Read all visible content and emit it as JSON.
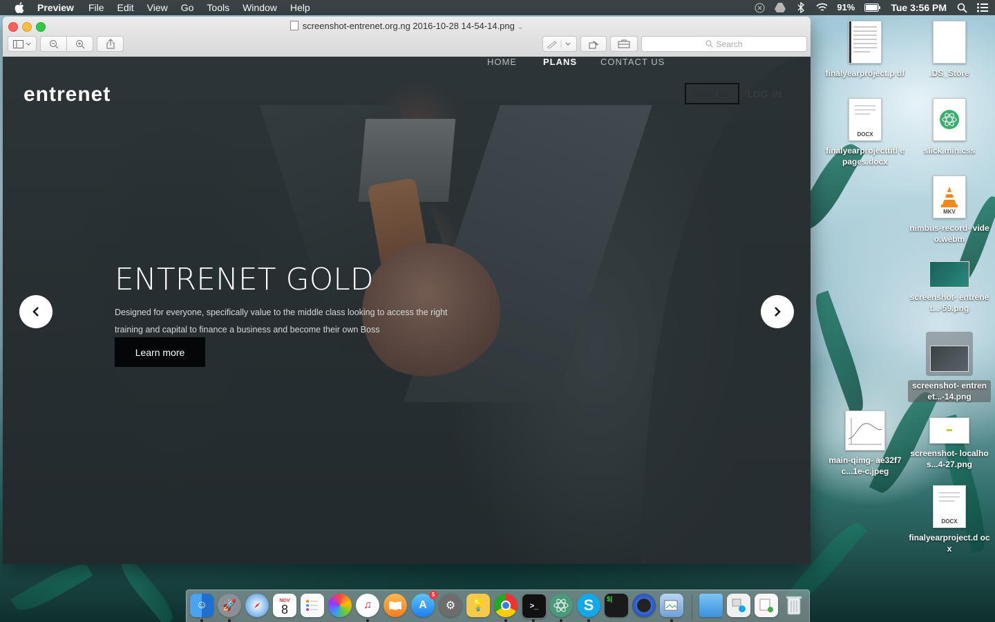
{
  "menubar": {
    "app_name": "Preview",
    "items": [
      "File",
      "Edit",
      "View",
      "Go",
      "Tools",
      "Window",
      "Help"
    ],
    "battery": "91%",
    "clock": "Tue 3:56 PM"
  },
  "window": {
    "document_title": "screenshot-entrenet.org.ng 2016-10-28 14-54-14.png",
    "search_placeholder": "Search"
  },
  "site": {
    "logo": "entrenet",
    "nav": [
      "HOME",
      "PLANS",
      "CONTACT US"
    ],
    "active_nav": "PLANS",
    "signup_label": "SIGN UP",
    "login_label": "LOG IN",
    "hero_title": "ENTRENET GOLD",
    "hero_desc_line1": "Designed for everyone, specifically value to the middle class looking to access the right",
    "hero_desc_line2": "training and capital to finance a business and become their own Boss",
    "learn_more": "Learn more",
    "prev_arrow": "‹",
    "next_arrow": "›"
  },
  "desktop_icons": [
    {
      "name": "finalyearproject.pdf",
      "label": "finalyearproject.p df",
      "kind": "pdf"
    },
    {
      "name": ".DS_Store",
      "label": ".DS_Store",
      "kind": "blank"
    },
    {
      "name": "finalyearprojecttitlepages.docx",
      "label": "finalyearprojecttitl epages.docx",
      "kind": "docx",
      "badge": "DOCX"
    },
    {
      "name": "slick.min.css",
      "label": "slick.min.css",
      "kind": "atom"
    },
    {
      "name": "nimbus-record-video.webm",
      "label": "nimbus-record- video.webm",
      "kind": "mkv",
      "badge": "MKV"
    },
    {
      "name": "screenshot-entrenet...-59.png",
      "label": "screenshot- entrenet...-59.png",
      "kind": "image"
    },
    {
      "name": "screenshot-entrenet...-14.png",
      "label": "screenshot- entrenet...-14.png",
      "kind": "image",
      "selected": true
    },
    {
      "name": "main-qimg-ae32f7c...1e-c.jpeg",
      "label": "main-qimg- ae32f7c...1e-c.jpeg",
      "kind": "sketch"
    },
    {
      "name": "screenshot-localhos...4-27.png",
      "label": "screenshot- localhos...4-27.png",
      "kind": "white"
    },
    {
      "name": "finalyearproject.docx",
      "label": "finalyearproject.d ocx",
      "kind": "docx",
      "badge": "DOCX"
    }
  ],
  "dock": {
    "calendar_month": "NOV",
    "calendar_day": "8",
    "app_store_badge": "5",
    "terminal_prompt": ">_",
    "skype_letter": "S"
  },
  "colors": {
    "accent_white": "#ffffff",
    "learn_btn_bg": "#050607",
    "menubar_bg": "#1e1e1e"
  }
}
